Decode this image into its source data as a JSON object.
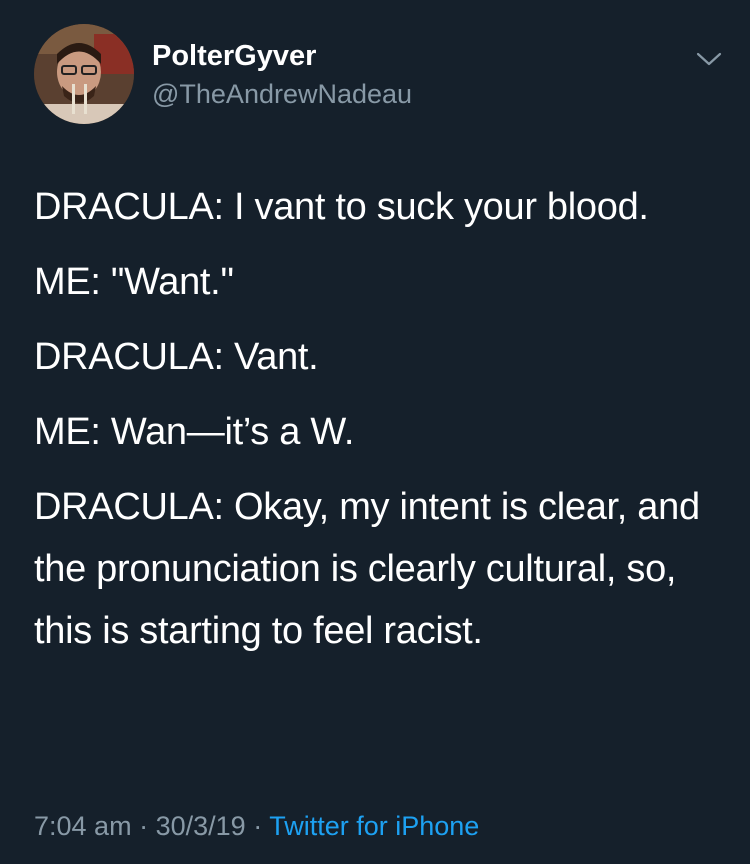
{
  "tweet": {
    "display_name": "PolterGyver",
    "handle": "@TheAndrewNadeau",
    "avatar_icon": "profile-photo",
    "menu_icon": "chevron-down-icon",
    "lines": [
      "DRACULA: I vant to suck your blood.",
      "ME: \"Want.\"",
      "DRACULA: Vant.",
      "ME: Wan—it’s a W.",
      "DRACULA: Okay, my intent is clear, and the pronunciation is clearly cultural, so, this is starting to feel racist."
    ],
    "time": "7:04 am",
    "date": "30/3/19",
    "separator": "·",
    "source": "Twitter for iPhone"
  },
  "colors": {
    "background": "#15202b",
    "text": "#ffffff",
    "secondary": "#8899a6",
    "link": "#1da1f2"
  }
}
